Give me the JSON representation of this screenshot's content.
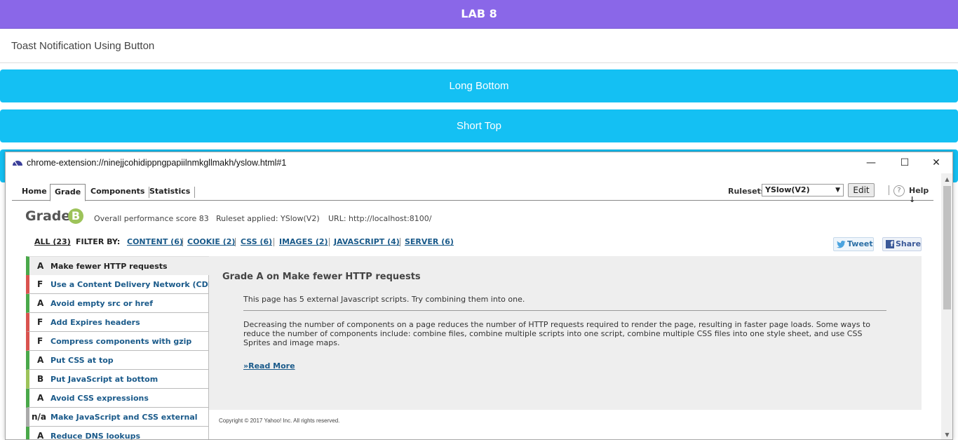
{
  "app": {
    "title": "LAB 8",
    "subtitle": "Toast Notification Using Button",
    "buttons": [
      "Long Bottom",
      "Short Top"
    ],
    "accent_color": "#8a67e8",
    "button_color": "#14c0f3"
  },
  "popup": {
    "url": "chrome-extension://ninejjcohidippngpapiilnmkgllmakh/yslow.html#1",
    "controls": {
      "minimize": "—",
      "maximize": "☐",
      "close": "✕"
    },
    "tabs": [
      "Home",
      "Grade",
      "Components",
      "Statistics"
    ],
    "active_tab": "Grade",
    "rulesets": {
      "label": "Rulesets",
      "selected": "YSlow(V2)",
      "edit_label": "Edit",
      "help_label": "Help ↓",
      "help_icon": "?"
    },
    "grade": {
      "label": "Grade",
      "letter": "B",
      "score_text": "Overall performance score 83",
      "ruleset_text": "Ruleset applied: YSlow(V2)",
      "url_text": "URL: http://localhost:8100/"
    },
    "filters": {
      "all": "ALL (23)",
      "label": "FILTER BY:",
      "items": [
        "CONTENT (6)",
        "COOKIE (2)",
        "CSS (6)",
        "IMAGES (2)",
        "JAVASCRIPT (4)",
        "SERVER (6)"
      ]
    },
    "social": {
      "tweet": "Tweet",
      "share": "Share"
    },
    "rules": [
      {
        "grade": "A",
        "title": "Make fewer HTTP requests"
      },
      {
        "grade": "F",
        "title": "Use a Content Delivery Network (CDN)"
      },
      {
        "grade": "A",
        "title": "Avoid empty src or href"
      },
      {
        "grade": "F",
        "title": "Add Expires headers"
      },
      {
        "grade": "F",
        "title": "Compress components with gzip"
      },
      {
        "grade": "A",
        "title": "Put CSS at top"
      },
      {
        "grade": "B",
        "title": "Put JavaScript at bottom"
      },
      {
        "grade": "A",
        "title": "Avoid CSS expressions"
      },
      {
        "grade": "n/a",
        "title": "Make JavaScript and CSS external"
      },
      {
        "grade": "A",
        "title": "Reduce DNS lookups"
      }
    ],
    "detail": {
      "title": "Grade A on Make fewer HTTP requests",
      "message": "This page has 5 external Javascript scripts. Try combining them into one.",
      "description": "Decreasing the number of components on a page reduces the number of HTTP requests required to render the page, resulting in faster page loads. Some ways to reduce the number of components include: combine files, combine multiple scripts into one script, combine multiple CSS files into one style sheet, and use CSS Sprites and image maps.",
      "read_more": "»Read More"
    },
    "copyright": "Copyright © 2017 Yahoo! Inc. All rights reserved.",
    "grade_colors": {
      "A": "#4aa84a",
      "B": "#9dc35a",
      "F": "#d9534f",
      "n/a": "#aaaaaa"
    }
  }
}
